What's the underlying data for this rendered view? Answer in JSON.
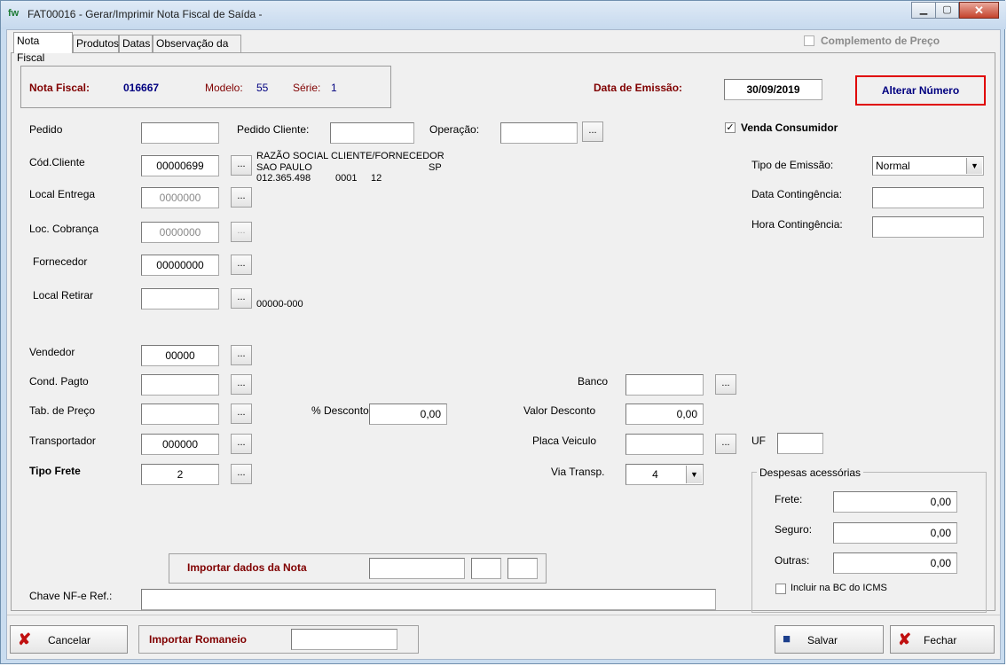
{
  "window": {
    "icon": "fw",
    "title": "FAT00016 - Gerar/Imprimir Nota Fiscal de Saída -",
    "minimize": "▁",
    "maximize": "▢",
    "close": "✕"
  },
  "tabs": [
    "Nota Fiscal",
    "Produtos",
    "Datas",
    "Observação da NF"
  ],
  "complemento_preco": {
    "label": "Complemento de Preço",
    "checked": false
  },
  "header": {
    "nf_label": "Nota Fiscal:",
    "nf_value": "016667",
    "modelo_label": "Modelo:",
    "modelo_value": "55",
    "serie_label": "Série:",
    "serie_value": "1",
    "data_emissao_label": "Data de Emissão:",
    "data_emissao_value": "30/09/2019",
    "alterar_numero": "Alterar Número"
  },
  "fields": {
    "pedido": {
      "label": "Pedido",
      "value": ""
    },
    "pedido_cliente": {
      "label": "Pedido Cliente:",
      "value": ""
    },
    "operacao": {
      "label": "Operação:",
      "value": ""
    },
    "cod_cliente": {
      "label": "Cód.Cliente",
      "value": "00000699"
    },
    "local_entrega": {
      "label": "Local Entrega",
      "value": "0000000"
    },
    "loc_cobranca": {
      "label": "Loc. Cobrança",
      "value": "0000000"
    },
    "fornecedor": {
      "label": "Fornecedor",
      "value": "00000000"
    },
    "local_retirar": {
      "label": "Local Retirar",
      "value": "",
      "cep": "00000-000"
    },
    "vendedor": {
      "label": "Vendedor",
      "value": "00000"
    },
    "cond_pagto": {
      "label": "Cond. Pagto",
      "value": ""
    },
    "tab_preco": {
      "label": "Tab. de Preço",
      "value": ""
    },
    "transportador": {
      "label": "Transportador",
      "value": "000000"
    },
    "tipo_frete": {
      "label": "Tipo Frete",
      "value": "2"
    },
    "pct_desconto": {
      "label": "% Desconto",
      "value": "0,00"
    },
    "banco": {
      "label": "Banco",
      "value": ""
    },
    "valor_desconto": {
      "label": "Valor Desconto",
      "value": "0,00"
    },
    "placa_veiculo": {
      "label": "Placa Veiculo",
      "value": ""
    },
    "uf": {
      "label": "UF",
      "value": ""
    },
    "via_transp": {
      "label": "Via Transp.",
      "value": "4"
    },
    "chave_nfe_ref": {
      "label": "Chave NF-e Ref.:",
      "value": ""
    }
  },
  "dots": "...",
  "cliente_info": {
    "razao_social": "RAZÃO SOCIAL CLIENTE/FORNECEDOR",
    "cidade": "SAO PAULO",
    "uf": "SP",
    "cnpj": "012.365.498",
    "filial": "0001",
    "digito": "12"
  },
  "venda_consumidor": {
    "label": "Venda Consumidor",
    "checked": true
  },
  "tipo_emissao": {
    "label": "Tipo de Emissão:",
    "value": "Normal"
  },
  "data_contingencia": {
    "label": "Data Contingência:",
    "value": ""
  },
  "hora_contingencia": {
    "label": "Hora Contingência:",
    "value": ""
  },
  "despesas": {
    "title": "Despesas acessórias",
    "frete": {
      "label": "Frete:",
      "value": "0,00"
    },
    "seguro": {
      "label": "Seguro:",
      "value": "0,00"
    },
    "outras": {
      "label": "Outras:",
      "value": "0,00"
    },
    "incluir_bc": {
      "label": "Incluir na BC do ICMS",
      "checked": false
    }
  },
  "importar_nota": {
    "label": "Importar dados da Nota",
    "v1": "",
    "v2": "",
    "v3": ""
  },
  "bottom": {
    "cancelar": "Cancelar",
    "importar_romaneio": "Importar Romaneio",
    "romaneio_value": "",
    "salvar": "Salvar",
    "fechar": "Fechar"
  },
  "colors": {
    "maroon": "#800000",
    "navy": "#000080",
    "alert_border": "#e00000"
  }
}
